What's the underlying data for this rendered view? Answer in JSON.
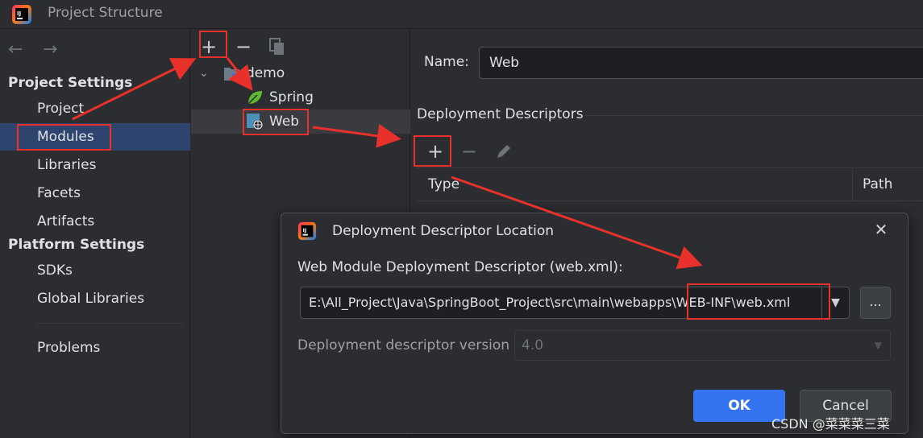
{
  "window": {
    "title": "Project Structure"
  },
  "nav": {
    "back_icon": "arrow-left-icon",
    "forward_icon": "arrow-right-icon"
  },
  "sidebar": {
    "project_settings_header": "Project Settings",
    "project_items": [
      "Project",
      "Modules",
      "Libraries",
      "Facets",
      "Artifacts"
    ],
    "platform_settings_header": "Platform Settings",
    "platform_items": [
      "SDKs",
      "Global Libraries"
    ],
    "problems": "Problems",
    "selected": "Modules"
  },
  "module_tree": {
    "toolbar": {
      "add": "+",
      "remove": "−",
      "copy_icon": "copy-icon"
    },
    "root": "demo",
    "children": [
      "Spring",
      "Web"
    ],
    "selected": "Web"
  },
  "details": {
    "name_label": "Name:",
    "name_value": "Web",
    "deployment_descriptors_title": "Deployment Descriptors",
    "table_headers": [
      "Type",
      "Path"
    ]
  },
  "dialog": {
    "title": "Deployment Descriptor Location",
    "field_label": "Web Module Deployment Descriptor (web.xml):",
    "path_value": "E:\\All_Project\\Java\\SpringBoot_Project\\src\\main\\webapps\\WEB-INF\\web.xml",
    "browse_label": "...",
    "version_label": "Deployment descriptor version",
    "version_value": "4.0",
    "ok_label": "OK",
    "cancel_label": "Cancel"
  },
  "watermark": "CSDN @菜菜菜三菜",
  "colors": {
    "accent": "#3574f0",
    "selection": "#2e436e",
    "annotation": "#e8312b",
    "background": "#2b2d30"
  }
}
